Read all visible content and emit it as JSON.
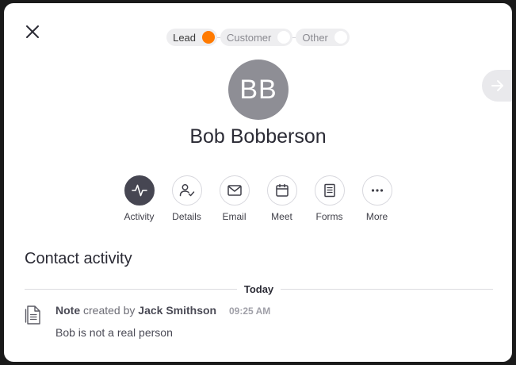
{
  "stages": [
    {
      "label": "Lead",
      "active": true
    },
    {
      "label": "Customer",
      "active": false
    },
    {
      "label": "Other",
      "active": false
    }
  ],
  "contact": {
    "initials": "BB",
    "name": "Bob Bobberson"
  },
  "actions": [
    {
      "label": "Activity",
      "icon": "activity-icon",
      "selected": true
    },
    {
      "label": "Details",
      "icon": "person-check-icon",
      "selected": false
    },
    {
      "label": "Email",
      "icon": "envelope-icon",
      "selected": false
    },
    {
      "label": "Meet",
      "icon": "calendar-icon",
      "selected": false
    },
    {
      "label": "Forms",
      "icon": "form-icon",
      "selected": false
    },
    {
      "label": "More",
      "icon": "more-icon",
      "selected": false
    }
  ],
  "activity": {
    "section_title": "Contact activity",
    "day_label": "Today",
    "items": [
      {
        "type_label": "Note",
        "created_by_text": "created by",
        "author": "Jack Smithson",
        "time": "09:25 AM",
        "body": "Bob is not a real person"
      }
    ]
  },
  "colors": {
    "lead_accent": "#ff7a00",
    "avatar_bg": "#8e8e95",
    "selected_action_bg": "#464652"
  }
}
